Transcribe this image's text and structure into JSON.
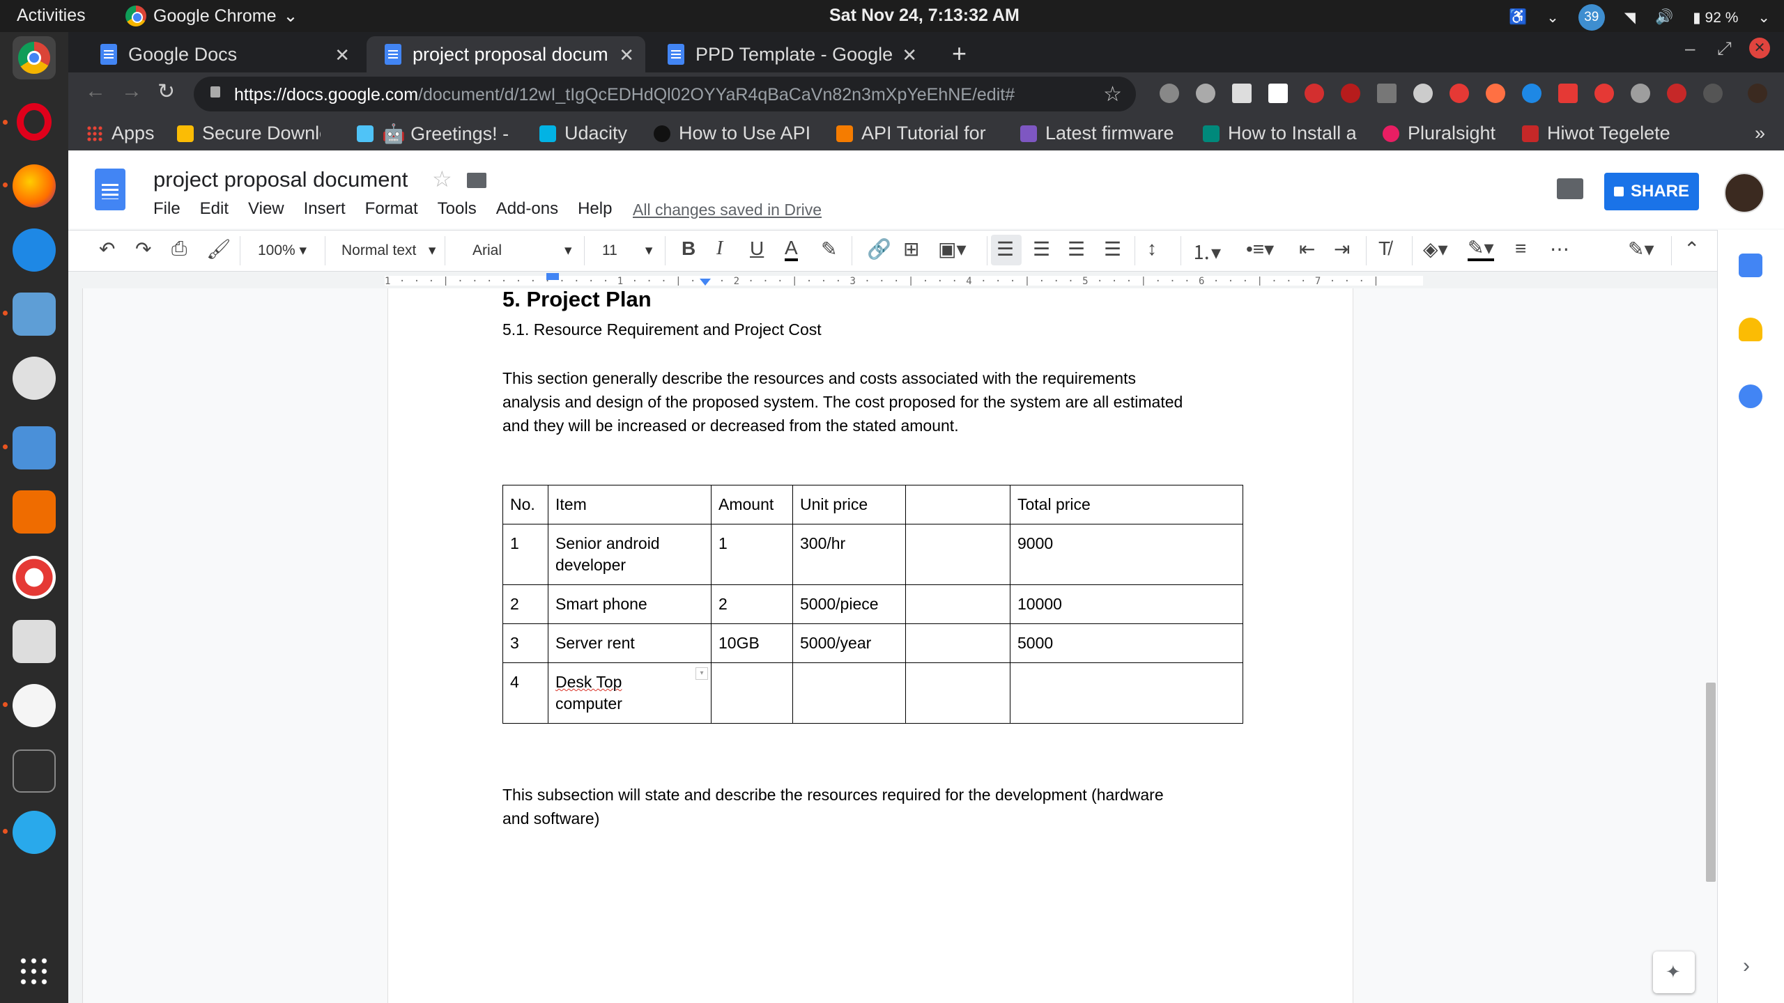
{
  "system_bar": {
    "activities": "Activities",
    "app_name": "Google Chrome",
    "clock": "Sat Nov 24,  7:13:32 AM",
    "notification_count": "39",
    "battery": "92 %"
  },
  "browser": {
    "tabs": [
      {
        "title": "Google Docs"
      },
      {
        "title": "project proposal docum"
      },
      {
        "title": "PPD Template - Google"
      }
    ],
    "url_host": "https://docs.google.com",
    "url_path": "/document/d/12wI_tIgQcEDHdQl02OYYaR4qBaCaVn82n3mXpYeEhNE/edit#",
    "bookmarks": [
      {
        "label": "Apps",
        "color": "#ea4335"
      },
      {
        "label": "Secure Downlo",
        "color": "#fbbc05"
      },
      {
        "label": "🤖 Greetings! -",
        "color": "#4fc3f7"
      },
      {
        "label": "Udacity",
        "color": "#02b3e4"
      },
      {
        "label": "How to Use API",
        "color": "#111111"
      },
      {
        "label": "API Tutorial for",
        "color": "#f57c00"
      },
      {
        "label": "Latest firmware",
        "color": "#7e57c2"
      },
      {
        "label": "How to Install a",
        "color": "#00897b"
      },
      {
        "label": "Pluralsight",
        "color": "#e91e63"
      },
      {
        "label": "Hiwot Tegelete",
        "color": "#c62828"
      }
    ],
    "bookmarks_more": "»"
  },
  "docs": {
    "title": "project proposal document",
    "menu": [
      "File",
      "Edit",
      "View",
      "Insert",
      "Format",
      "Tools",
      "Add-ons",
      "Help"
    ],
    "save_status": "All changes saved in Drive",
    "share_label": "SHARE",
    "toolbar": {
      "zoom": "100%",
      "style": "Normal text",
      "font": "Arial",
      "font_size": "11"
    },
    "ruler_text": "1 · · · | · · · · · · · · · · · 1 · · · | · · · 2 · · · | · · · 3 · · · | · · · 4 · · · | · · · 5 · · · | · · · 6 · · · | · · · 7 · · · |"
  },
  "document": {
    "heading": "5. Project Plan",
    "subheading": "5.1. Resource Requirement  and Project Cost",
    "paragraph1_lines": [
      "This section generally describe the resources and costs associated with the requirements",
      "analysis and design of the proposed system. The cost proposed for the system are all estimated",
      "and they will be increased or decreased from the stated amount."
    ],
    "table": {
      "headers": [
        "No.",
        "Item",
        "Amount",
        "Unit price",
        "",
        "Total price"
      ],
      "rows": [
        [
          "1",
          "Senior android developer",
          "1",
          "300/hr",
          "",
          "9000"
        ],
        [
          "2",
          "Smart phone",
          "2",
          "5000/piece",
          "",
          "10000"
        ],
        [
          "3",
          "Server rent",
          "10GB",
          "5000/year",
          "",
          "5000"
        ],
        [
          "4",
          "Desk Top computer",
          "",
          "",
          "",
          ""
        ]
      ],
      "row4_item_line1": "Desk Top",
      "row4_item_line2": "computer"
    },
    "paragraph2_lines": [
      "This subsection will state and describe the resources required for the development (hardware",
      "and software)"
    ]
  }
}
